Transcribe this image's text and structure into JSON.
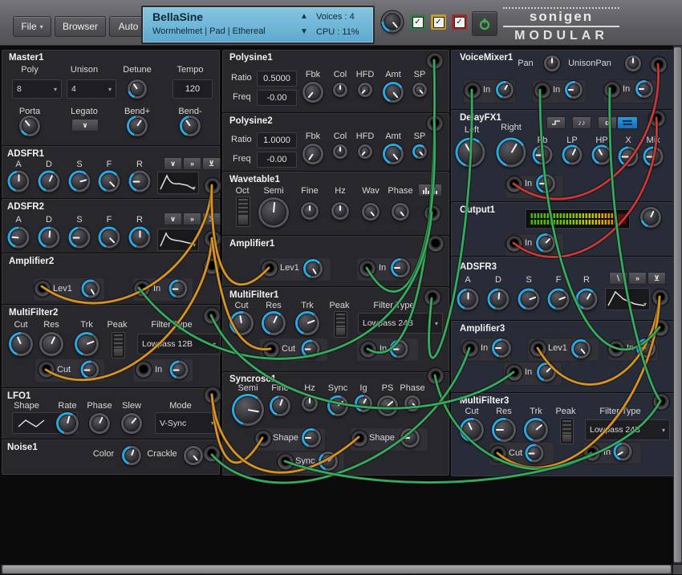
{
  "header": {
    "file_button": "File",
    "browser_button": "Browser",
    "auto_button": "Auto",
    "patch_name": "BellaSine",
    "patch_meta": "Wormhelmet | Pad | Ethereal",
    "voices": "Voices : 4",
    "cpu": "CPU : 11%",
    "brand_top": "sonigen",
    "brand_bottom": "MODULAR"
  },
  "shared": {
    "in": "In",
    "lev1": "Lev1",
    "cut": "Cut",
    "shape": "Shape",
    "sync": "Sync"
  },
  "modules": {
    "master1": {
      "title": "Master1",
      "poly": "Poly",
      "poly_value": "8",
      "unison": "Unison",
      "unison_value": "4",
      "detune": "Detune",
      "tempo": "Tempo",
      "tempo_value": "120",
      "porta": "Porta",
      "legato": "Legato",
      "bend_plus": "Bend+",
      "bend_minus": "Bend-"
    },
    "adsfr1": {
      "title": "ADSFR1"
    },
    "adsfr2": {
      "title": "ADSFR2"
    },
    "adsfr3": {
      "title": "ADSFR3"
    },
    "adsfr_labels": {
      "a": "A",
      "d": "D",
      "s": "S",
      "f": "F",
      "r": "R"
    },
    "amplifier1": {
      "title": "Amplifier1"
    },
    "amplifier2": {
      "title": "Amplifier2"
    },
    "amplifier3": {
      "title": "Amplifier3"
    },
    "multifilter1": {
      "title": "MultiFilter1",
      "cut": "Cut",
      "res": "Res",
      "trk": "Trk",
      "peak": "Peak",
      "filter_type": "Filter Type",
      "type_value": "Lowpass 24B"
    },
    "multifilter2": {
      "title": "MultiFilter2",
      "cut": "Cut",
      "res": "Res",
      "trk": "Trk",
      "peak": "Peak",
      "filter_type": "Filter Type",
      "type_value": "Lowpass 12B"
    },
    "multifilter3": {
      "title": "MultiFilter3",
      "cut": "Cut",
      "res": "Res",
      "trk": "Trk",
      "peak": "Peak",
      "filter_type": "Filter Type",
      "type_value": "Lowpass 24B"
    },
    "lfo1": {
      "title": "LFO1",
      "shape": "Shape",
      "rate": "Rate",
      "phase": "Phase",
      "slew": "Slew",
      "mode": "Mode",
      "mode_value": "V-Sync"
    },
    "noise1": {
      "title": "Noise1",
      "color": "Color",
      "crackle": "Crackle"
    },
    "polysine1": {
      "title": "Polysine1",
      "ratio": "Ratio",
      "ratio_value": "0.5000",
      "freq": "Freq",
      "freq_value": "-0.00",
      "fbk": "Fbk",
      "col": "Col",
      "hfd": "HFD",
      "amt": "Amt",
      "sp": "SP"
    },
    "polysine2": {
      "title": "Polysine2",
      "ratio": "Ratio",
      "ratio_value": "1.0000",
      "freq": "Freq",
      "freq_value": "-0.00",
      "fbk": "Fbk",
      "col": "Col",
      "hfd": "HFD",
      "amt": "Amt",
      "sp": "SP"
    },
    "wavetable1": {
      "title": "Wavetable1",
      "oct": "Oct",
      "semi": "Semi",
      "fine": "Fine",
      "hz": "Hz",
      "wav": "Wav",
      "phase": "Phase"
    },
    "syncrosc1": {
      "title": "Syncrosc1",
      "semi": "Semi",
      "fine": "Fine",
      "hz": "Hz",
      "sync": "Sync",
      "ig": "Ig",
      "ps": "PS",
      "phase": "Phase"
    },
    "voicemixer1": {
      "title": "VoiceMixer1",
      "pan": "Pan",
      "unison_pan": "UnisonPan"
    },
    "delayfx1": {
      "title": "DelayFX1",
      "left": "Left",
      "right": "Right",
      "fb": "Fb",
      "lp": "LP",
      "hp": "HP",
      "x": "X",
      "mix": "Mix"
    },
    "output1": {
      "title": "Output1"
    }
  },
  "colors": {
    "accent_blue": "#2ea6e0",
    "lcd_blue": "#6fb8d9",
    "cable_green": "#2f9e54",
    "cable_orange": "#c9881e",
    "cable_red": "#b83030",
    "check_green": "#2f7d45",
    "check_yellow": "#c79a2a",
    "check_red": "#a42828"
  }
}
